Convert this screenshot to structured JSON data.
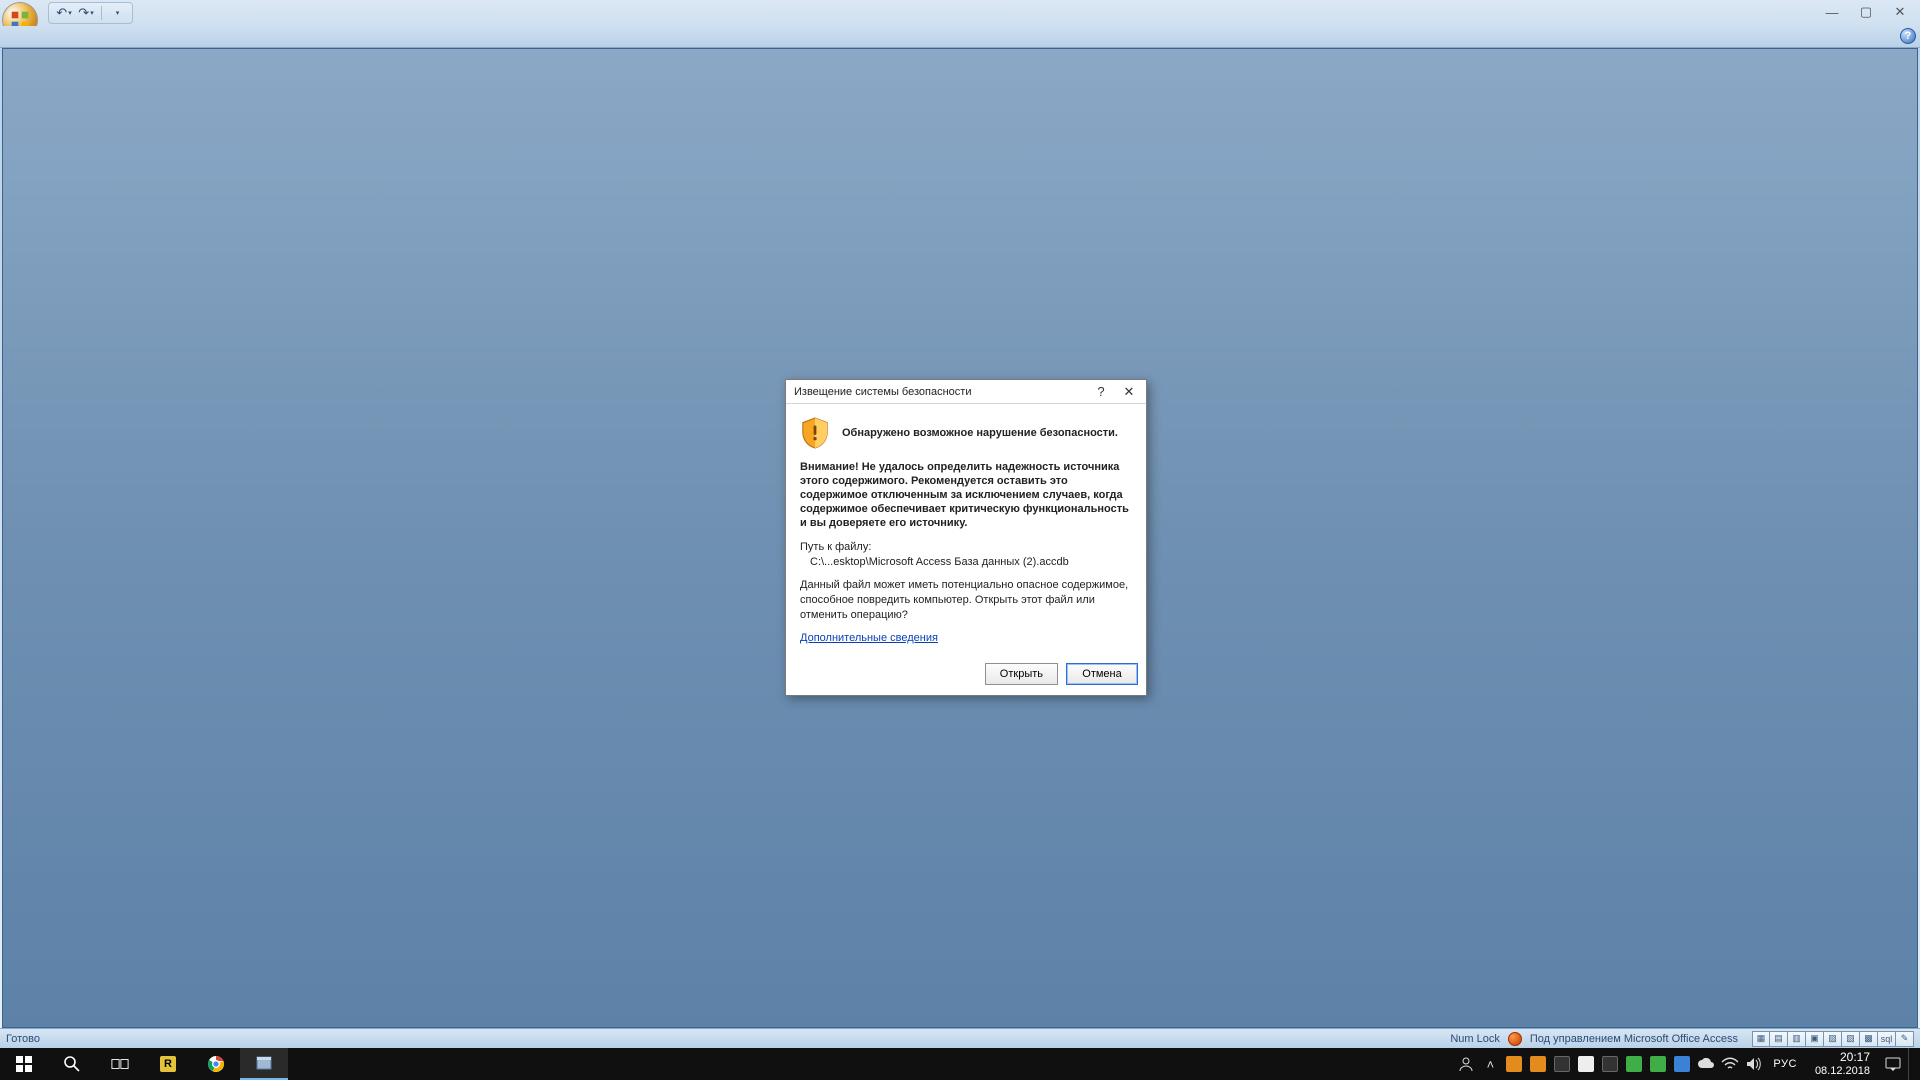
{
  "titlebar": {
    "undo_tip": "↶",
    "redo_tip": "↷"
  },
  "statusbar": {
    "ready": "Готово",
    "numlock": "Num Lock",
    "powered_by": "Под управлением Microsoft Office Access"
  },
  "dialog": {
    "title": "Извещение системы безопасности",
    "header": "Обнаружено возможное нарушение безопасности.",
    "warning": "Внимание! Не удалось определить надежность источника этого содержимого. Рекомендуется оставить это содержимое отключенным за исключением случаев, когда содержимое обеспечивает критическую функциональность и вы доверяете его источнику.",
    "path_label": "Путь к файлу:",
    "path_value": "C:\\...esktop\\Microsoft Access База данных (2).accdb",
    "body2": "Данный файл может иметь потенциально опасное содержимое, способное повредить компьютер. Открыть этот файл или отменить операцию?",
    "link": "Дополнительные сведения",
    "open_btn": "Открыть",
    "cancel_btn": "Отмена"
  },
  "taskbar": {
    "lang": "РУС",
    "time": "20:17",
    "date": "08.12.2018"
  }
}
